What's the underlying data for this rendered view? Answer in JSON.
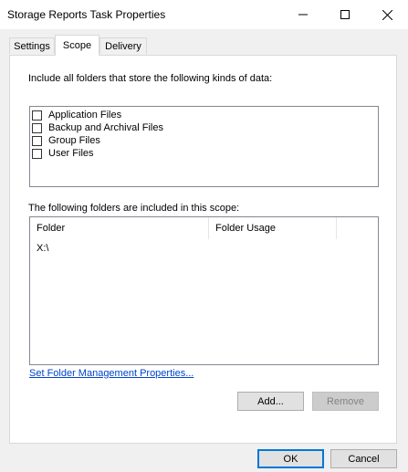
{
  "window": {
    "title": "Storage Reports Task Properties"
  },
  "tabs": [
    {
      "label": "Settings",
      "active": false
    },
    {
      "label": "Scope",
      "active": true
    },
    {
      "label": "Delivery",
      "active": false
    }
  ],
  "scope": {
    "include_label": "Include all folders that store the following kinds of data:",
    "data_kinds": [
      {
        "label": "Application Files",
        "checked": false
      },
      {
        "label": "Backup and Archival Files",
        "checked": false
      },
      {
        "label": "Group Files",
        "checked": false
      },
      {
        "label": "User Files",
        "checked": false
      }
    ],
    "folders_label": "The following folders are included in this scope:",
    "columns": [
      "Folder",
      "Folder Usage"
    ],
    "rows": [
      {
        "folder": "X:\\",
        "usage": ""
      }
    ],
    "link_label": "Set Folder Management Properties...",
    "add_label": "Add...",
    "remove_label": "Remove"
  },
  "footer": {
    "ok_label": "OK",
    "cancel_label": "Cancel"
  },
  "colors": {
    "accent": "#0078d7",
    "link": "#0044cc"
  }
}
